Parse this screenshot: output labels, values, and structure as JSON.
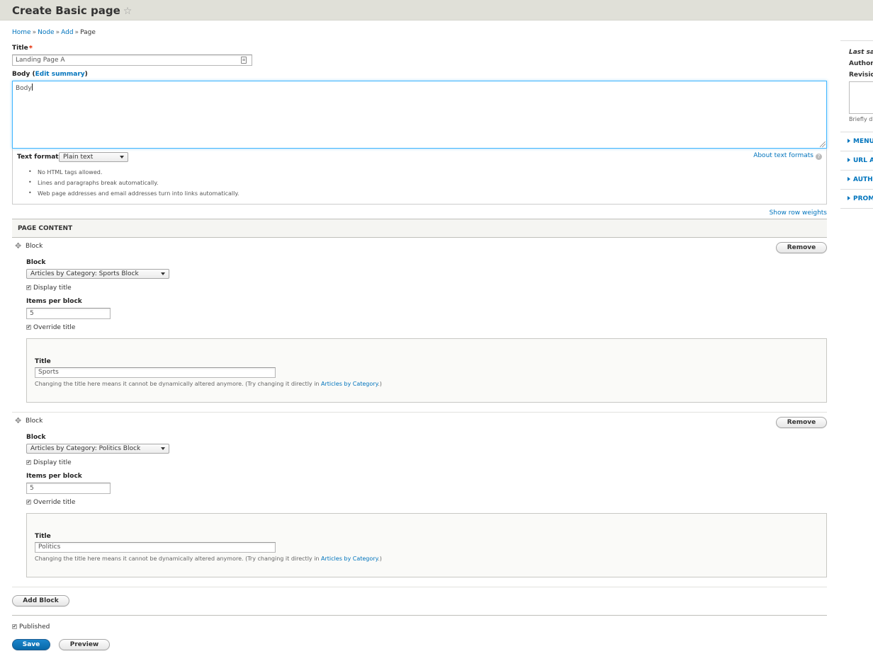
{
  "header": {
    "title": "Create Basic page",
    "star_icon": "star-outline-icon"
  },
  "breadcrumb": [
    "Home",
    "Node",
    "Add",
    "Page"
  ],
  "title_field": {
    "label": "Title",
    "required_marker": "*",
    "value": "Landing Page A"
  },
  "body_field": {
    "label": "Body",
    "edit_summary_link": "Edit summary",
    "value": "Body",
    "text_format_label": "Text format",
    "text_format_value": "Plain text",
    "about_link": "About text formats",
    "tips": [
      "No HTML tags allowed.",
      "Lines and paragraphs break automatically.",
      "Web page addresses and email addresses turn into links automatically."
    ]
  },
  "show_row_weights": "Show row weights",
  "page_content": {
    "heading": "PAGE CONTENT",
    "blocks": [
      {
        "row_label": "Block",
        "remove_label": "Remove",
        "block_label": "Block",
        "block_value": "Articles by Category: Sports Block",
        "display_title_label": "Display title",
        "display_title_checked": true,
        "items_label": "Items per block",
        "items_value": "5",
        "override_title_label": "Override title",
        "override_title_checked": true,
        "title_label": "Title",
        "title_value": "Sports",
        "help_text": "Changing the title here means it cannot be dynamically altered anymore. (Try changing it directly in",
        "help_link": "Articles by Category",
        "help_suffix": ".)"
      },
      {
        "row_label": "Block",
        "remove_label": "Remove",
        "block_label": "Block",
        "block_value": "Articles by Category: Politics Block",
        "display_title_label": "Display title",
        "display_title_checked": true,
        "items_label": "Items per block",
        "items_value": "5",
        "override_title_label": "Override title",
        "override_title_checked": true,
        "title_label": "Title",
        "title_value": "Politics",
        "help_text": "Changing the title here means it cannot be dynamically altered anymore. (Try changing it directly in",
        "help_link": "Articles by Category",
        "help_suffix": ".)"
      }
    ],
    "add_block_label": "Add Block"
  },
  "published": {
    "label": "Published",
    "checked": true
  },
  "actions": {
    "save": "Save",
    "preview": "Preview"
  },
  "sidebar": {
    "last_saved": "Last sa",
    "author": "Author",
    "revision": "Revisio",
    "revision_desc": "Briefly d",
    "sections": [
      "MENU",
      "URL A",
      "AUTH",
      "PROM"
    ]
  },
  "colors": {
    "link": "#0074bd",
    "primary_button": "#0a6fb5",
    "focus_border": "#40b6ff",
    "required": "#e32700"
  }
}
